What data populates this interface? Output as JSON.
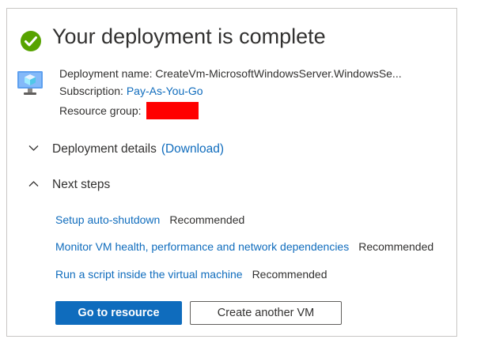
{
  "header": {
    "title": "Your deployment is complete",
    "status_icon": "check-circle-icon",
    "status_color": "#57a300"
  },
  "deployment": {
    "resource_icon": "virtual-machine-icon",
    "name_label": "Deployment name:",
    "name_value": "CreateVm-MicrosoftWindowsServer.WindowsSe...",
    "subscription_label": "Subscription:",
    "subscription_value": "Pay-As-You-Go",
    "resource_group_label": "Resource group:",
    "redaction_color": "#ff0000"
  },
  "sections": {
    "details": {
      "label": "Deployment details",
      "download_link": "(Download)",
      "chevron": "chevron-down-icon"
    },
    "next_steps": {
      "label": "Next steps",
      "chevron": "chevron-up-icon"
    }
  },
  "next_steps": [
    {
      "link": "Setup auto-shutdown",
      "tag": "Recommended"
    },
    {
      "link": "Monitor VM health, performance and network dependencies",
      "tag": "Recommended"
    },
    {
      "link": "Run a script inside the virtual machine",
      "tag": "Recommended"
    }
  ],
  "actions": {
    "primary": "Go to resource",
    "secondary": "Create another VM"
  },
  "colors": {
    "link": "#0f6cbd",
    "primary_button": "#0f6cbd"
  }
}
